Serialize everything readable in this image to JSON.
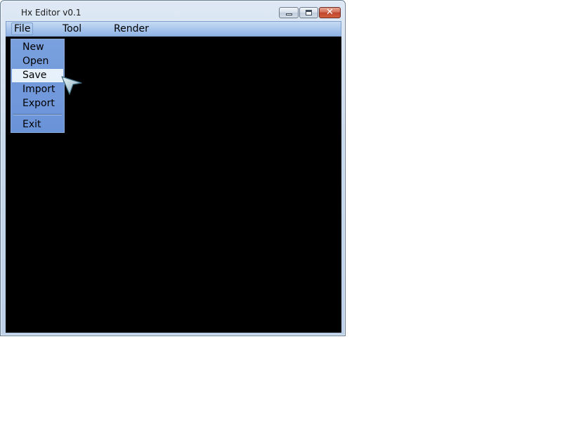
{
  "window": {
    "title": "Hx Editor v0.1",
    "close_glyph": "✕"
  },
  "menubar": {
    "items": [
      {
        "label": "File"
      },
      {
        "label": "Tool"
      },
      {
        "label": "Render"
      }
    ]
  },
  "file_menu": {
    "items": [
      {
        "label": "New"
      },
      {
        "label": "Open"
      },
      {
        "label": "Save",
        "selected": true
      },
      {
        "label": "Import"
      },
      {
        "label": "Export"
      },
      {
        "label": "Exit"
      }
    ]
  },
  "icons": {
    "minimize": "minimize-icon",
    "maximize": "maximize-icon",
    "close": "close-icon",
    "cursor": "mouse-pointer-icon"
  },
  "colors": {
    "canvas": "#000000",
    "menu_bg": "#6a93d8",
    "selected_item": "#e6f1fc",
    "close_button": "#c0442b"
  }
}
